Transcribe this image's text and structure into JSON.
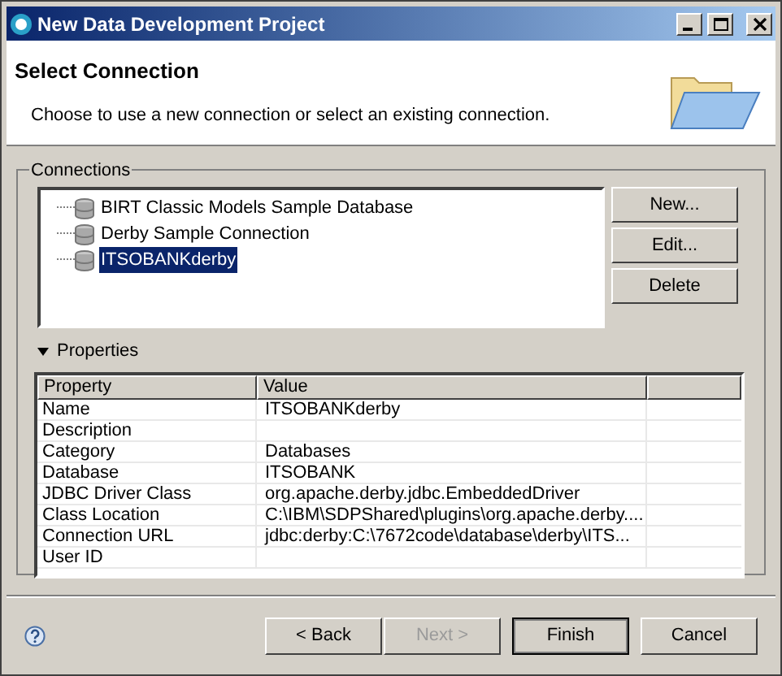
{
  "window": {
    "title": "New Data Development Project"
  },
  "header": {
    "title": "Select Connection",
    "description": "Choose to use a new connection or select an existing connection."
  },
  "connections": {
    "label": "Connections",
    "items": [
      {
        "label": "BIRT Classic Models Sample Database",
        "selected": false
      },
      {
        "label": "Derby Sample Connection",
        "selected": false
      },
      {
        "label": "ITSOBANKderby",
        "selected": true
      }
    ],
    "buttons": [
      "New...",
      "Edit...",
      "Delete"
    ]
  },
  "properties": {
    "label": "Properties",
    "expanded": true,
    "columns": [
      "Property",
      "Value"
    ],
    "rows": [
      [
        "Name",
        "ITSOBANKderby"
      ],
      [
        "Description",
        ""
      ],
      [
        "Category",
        "Databases"
      ],
      [
        "Database",
        "ITSOBANK"
      ],
      [
        "JDBC Driver Class",
        "org.apache.derby.jdbc.EmbeddedDriver"
      ],
      [
        "Class Location",
        "C:\\IBM\\SDPShared\\plugins\\org.apache.derby...."
      ],
      [
        "Connection URL",
        "jdbc:derby:C:\\7672code\\database\\derby\\ITS..."
      ],
      [
        "User ID",
        ""
      ]
    ]
  },
  "footer": {
    "buttons": [
      {
        "label": "< Back",
        "disabled": false,
        "default": false
      },
      {
        "label": "Next >",
        "disabled": true,
        "default": false
      },
      {
        "label": "Finish",
        "disabled": false,
        "default": true
      },
      {
        "label": "Cancel",
        "disabled": false,
        "default": false
      }
    ]
  }
}
